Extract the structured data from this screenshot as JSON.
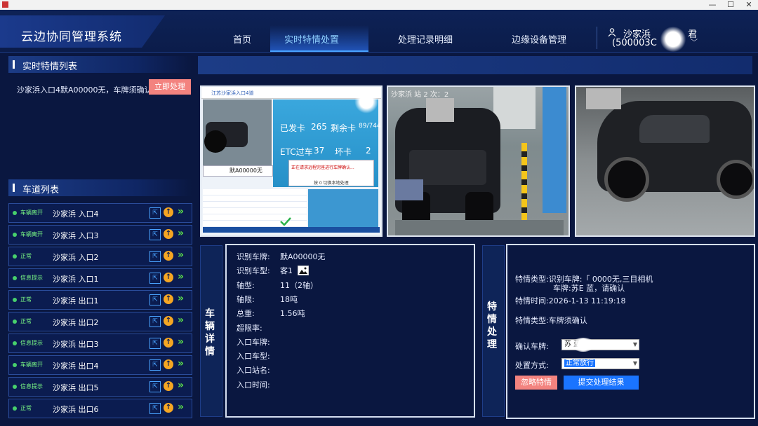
{
  "window": {
    "minimize": "—",
    "maximize": "☐",
    "close": "✕"
  },
  "app": {
    "title": "云边协同管理系统"
  },
  "nav": [
    "首页",
    "实时特情处置",
    "处理记录明细",
    "边缘设备管理"
  ],
  "user": {
    "name": "沙家浜",
    "suffix": "君",
    "id": "(500003C"
  },
  "realtime": {
    "heading": "实时特情列表",
    "item_text": "沙家浜入口4默A00000无，车牌须确认",
    "action_label": "立即处理"
  },
  "lanes_heading": "车道列表",
  "lanes": [
    {
      "status": "车辆离开",
      "name": "沙家浜 入口4"
    },
    {
      "status": "车辆离开",
      "name": "沙家浜 入口3"
    },
    {
      "status": "正常",
      "name": "沙家浜 入口2"
    },
    {
      "status": "信息提示",
      "name": "沙家浜 入口1"
    },
    {
      "status": "正常",
      "name": "沙家浜 出口1"
    },
    {
      "status": "正常",
      "name": "沙家浜 出口2"
    },
    {
      "status": "信息提示",
      "name": "沙家浜 出口3"
    },
    {
      "status": "车辆离开",
      "name": "沙家浜 出口4"
    },
    {
      "status": "信息提示",
      "name": "沙家浜 出口5"
    },
    {
      "status": "正常",
      "name": "沙家浜 出口6"
    }
  ],
  "lane_screen": {
    "title": "江苏沙家浜入口4道",
    "issued_label": "已发卡",
    "issued": "265",
    "remain_label": "剩余卡",
    "remain": "89/744",
    "etc_label": "ETC过车",
    "etc": "37",
    "bad_label": "坏卡",
    "bad": "2",
    "plate": "默A00000无",
    "msg": "正在请求远程完座进行车牌确认...",
    "sub": "按 0 切换本地处理"
  },
  "cam2_overlay": "沙家浜 站 2 次：2",
  "detail": {
    "label": "车辆详情",
    "fields": [
      {
        "k": "识别车牌:",
        "v": "默A00000无"
      },
      {
        "k": "识别车型:",
        "v": "客1"
      },
      {
        "k": "轴型:",
        "v": "11（2轴）"
      },
      {
        "k": "轴限:",
        "v": "18吨"
      },
      {
        "k": "总重:",
        "v": "1.56吨"
      },
      {
        "k": "超限率:",
        "v": ""
      },
      {
        "k": "入口车牌:",
        "v": ""
      },
      {
        "k": "入口车型:",
        "v": ""
      },
      {
        "k": "入口站名:",
        "v": ""
      },
      {
        "k": "入口时间:",
        "v": ""
      }
    ]
  },
  "handle": {
    "label": "特情处理",
    "type_line1": "特情类型:识别车牌:「 0000无,三目相机",
    "type_line2": "车牌:苏E    蓝，请确认",
    "time": "特情时间:2026-1-13   11:19:18",
    "type2": "特情类型:车牌须确认",
    "confirm_label": "确认车牌:",
    "confirm_value": "苏      蓝",
    "method_label": "处置方式:",
    "method_value": "正常放行",
    "ignore": "忽略特情",
    "submit": "提交处理结果"
  },
  "colors": {
    "accent": "#4aa3ff",
    "btn_red": "#f3837f",
    "btn_blue": "#1a74ff",
    "status_green": "#7dff86"
  }
}
